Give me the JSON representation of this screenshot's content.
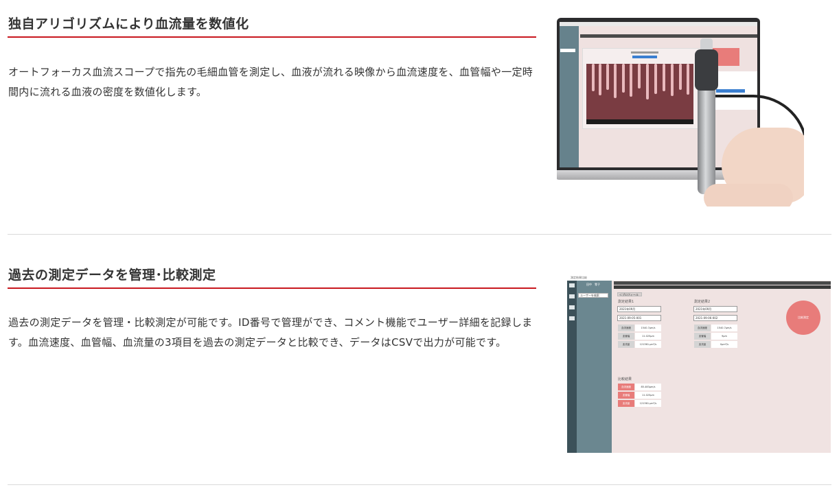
{
  "sections": [
    {
      "heading": "独自アリゴリズムにより血流量を数値化",
      "body": "オートフォーカス血流スコープで指先の毛細血管を測定し、血液が流れる映像から血流速度を、血管幅や一定時間内に流れる血液の密度を数値化します。"
    },
    {
      "heading": "過去の測定データを管理･比較測定",
      "body": "過去の測定データを管理・比較測定が可能です。ID番号で管理ができ、コメント機能でユーザー詳細を記録します。血流速度、血管幅、血流量の3項目を過去の測定データと比較でき、データはCSVで出力が可能です。"
    }
  ],
  "colors": {
    "accent": "#c8161d",
    "text": "#333333",
    "divider": "#d9d9d9",
    "app_sidebar": "#6b8790",
    "app_background": "#f0e3e2",
    "app_highlight": "#e87c7a"
  },
  "app_window": {
    "title": "測定結果比較",
    "user_name": "田中　零子",
    "search_placeholder": "ユーザーを検索",
    "profile_tab": "＜プロフィール",
    "result1_title": "測定結果1",
    "result2_title": "測定結果2",
    "result1_select1": "2021年09月",
    "result1_select2": "2021-09-05-001",
    "result2_select1": "2021年09月",
    "result2_select2": "2021-09-06-002",
    "metric_labels": [
      "血流速度",
      "血管幅",
      "血流量"
    ],
    "result1_values": [
      "1540.7μm/s",
      "11.025μm",
      "121361.μm³/s"
    ],
    "result2_values": [
      "1540.7μm/s",
      "9μm",
      "0μm³/s"
    ],
    "compare_title": "比較結果",
    "compare_values": [
      "85.483μm/s",
      "11.025μm",
      "121361.μm³/s"
    ],
    "compare_button": "比較測定"
  }
}
